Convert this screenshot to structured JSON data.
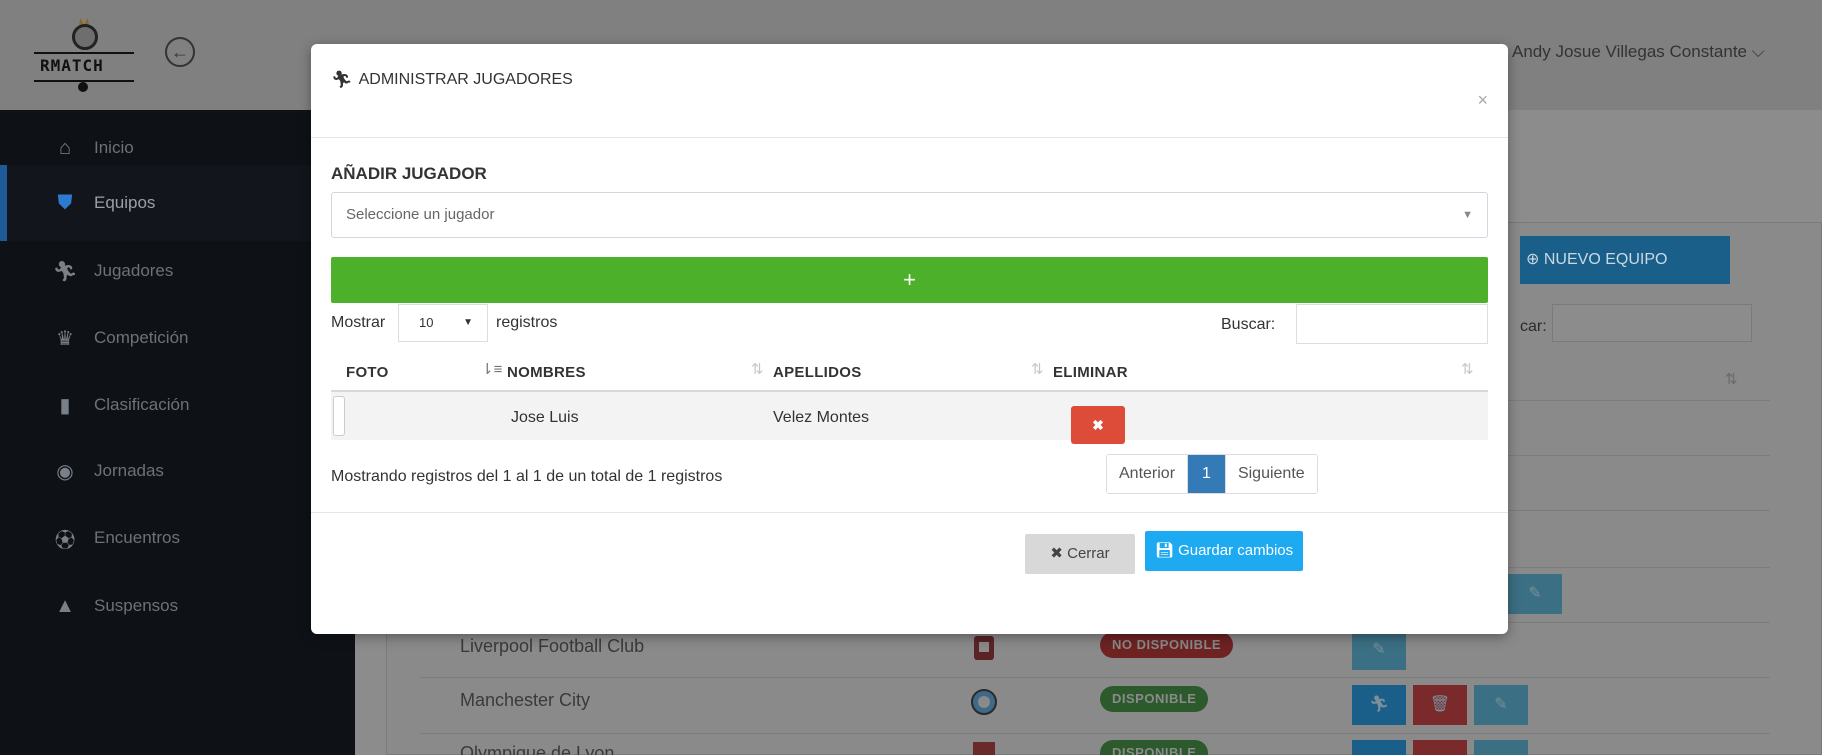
{
  "app": {
    "logo_text": "RMATCH",
    "user_name": "Andy Josue Villegas Constante"
  },
  "sidebar": {
    "items": [
      {
        "label": "Inicio",
        "icon": "home-icon"
      },
      {
        "label": "Equipos",
        "icon": "shield-icon"
      },
      {
        "label": "Jugadores",
        "icon": "running-icon"
      },
      {
        "label": "Competición",
        "icon": "trophy-icon"
      },
      {
        "label": "Clasificación",
        "icon": "clipboard-icon"
      },
      {
        "label": "Jornadas",
        "icon": "clock-icon"
      },
      {
        "label": "Encuentros",
        "icon": "soccer-ball-icon"
      },
      {
        "label": "Suspensos",
        "icon": "warning-icon"
      }
    ],
    "active_index": 1
  },
  "background": {
    "new_team_button": "NUEVO EQUIPO",
    "search_label": "car:",
    "teams": [
      {
        "name": "Liverpool Football Club",
        "status": "NO DISPONIBLE"
      },
      {
        "name": "Manchester City",
        "status": "DISPONIBLE"
      },
      {
        "name": "Olympique de Lyon",
        "status": "DISPONIBLE"
      }
    ]
  },
  "modal": {
    "title": "ADMINISTRAR JUGADORES",
    "close_symbol": "×",
    "section_title": "AÑADIR JUGADOR",
    "select_placeholder": "Seleccione un jugador",
    "add_button": "+",
    "length": {
      "label_before": "Mostrar",
      "value": "10",
      "label_after": "registros"
    },
    "search_label": "Buscar:",
    "columns": [
      "FOTO",
      "NOMBRES",
      "APELLIDOS",
      "ELIMINAR"
    ],
    "rows": [
      {
        "nombres": "Jose Luis",
        "apellidos": "Velez Montes"
      }
    ],
    "info": "Mostrando registros del 1 al 1 de un total de 1 registros",
    "pagination": {
      "previous": "Anterior",
      "current": "1",
      "next": "Siguiente"
    },
    "footer": {
      "close_button": "Cerrar",
      "save_button": "Guardar cambios"
    }
  },
  "colors": {
    "add_green": "#4cb02a",
    "save_blue": "#1eaaf1",
    "delete_red": "#dd4b39",
    "pager_active": "#337ab7"
  }
}
